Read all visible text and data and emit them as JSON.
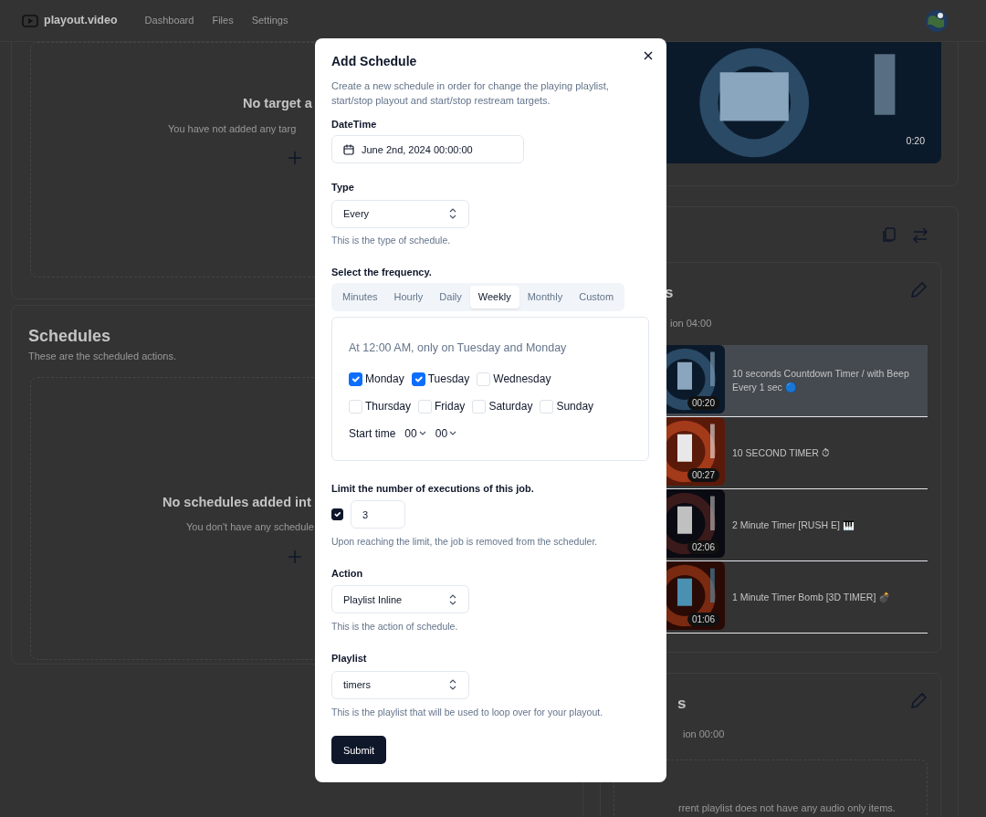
{
  "navbar": {
    "brand": "playout.video",
    "links": [
      {
        "label": "Dashboard"
      },
      {
        "label": "Files"
      },
      {
        "label": "Settings"
      }
    ]
  },
  "targets": {
    "empty_title": "No target a",
    "empty_text": "You have not added any targ"
  },
  "schedules": {
    "title": "Schedules",
    "subtitle": "These are the scheduled actions.",
    "empty_title": "No schedules added int",
    "empty_text": "You don't have any schedule"
  },
  "player": {
    "duration": "0:20"
  },
  "playlists": [
    {
      "title": "s",
      "subtitle": "ion 04:00",
      "items": [
        {
          "title": "10 seconds Countdown Timer / with Beep Every 1 sec 🔵",
          "duration": "00:20",
          "selected": true
        },
        {
          "title": "10 SECOND TIMER ⏱",
          "duration": "00:27",
          "selected": false
        },
        {
          "title": "2 Minute Timer [RUSH E] 🎹",
          "duration": "02:06",
          "selected": false
        },
        {
          "title": "1 Minute Timer Bomb [3D TIMER] 💣",
          "duration": "01:06",
          "selected": false
        }
      ]
    },
    {
      "title": "s",
      "subtitle": "ion 00:00",
      "empty_text": "rrent playlist does not have any audio only items."
    }
  ],
  "modal": {
    "title": "Add Schedule",
    "description": "Create a new schedule in order for change the playing playlist, start/stop playout and start/stop restream targets.",
    "datetime": {
      "label": "DateTime",
      "value": "June 2nd, 2024 00:00:00"
    },
    "type": {
      "label": "Type",
      "value": "Every",
      "help": "This is the type of schedule."
    },
    "frequency": {
      "label": "Select the frequency.",
      "tabs": [
        {
          "label": "Minutes",
          "selected": false
        },
        {
          "label": "Hourly",
          "selected": false
        },
        {
          "label": "Daily",
          "selected": false
        },
        {
          "label": "Weekly",
          "selected": true
        },
        {
          "label": "Monthly",
          "selected": false
        },
        {
          "label": "Custom",
          "selected": false
        }
      ],
      "summary": "At 12:00 AM, only on Tuesday and Monday",
      "day_rows": [
        [
          {
            "label": "Monday",
            "checked": true
          },
          {
            "label": "Tuesday",
            "checked": true
          },
          {
            "label": "Wednesday",
            "checked": false
          }
        ],
        [
          {
            "label": "Thursday",
            "checked": false
          },
          {
            "label": "Friday",
            "checked": false
          },
          {
            "label": "Saturday",
            "checked": false
          },
          {
            "label": "Sunday",
            "checked": false
          }
        ]
      ],
      "start_time": {
        "label": "Start time",
        "hour": "00",
        "minute": "00"
      }
    },
    "limit": {
      "label": "Limit the number of executions of this job.",
      "checked": true,
      "value": "3",
      "help": "Upon reaching the limit, the job is removed from the scheduler."
    },
    "action": {
      "label": "Action",
      "value": "Playlist Inline",
      "help": "This is the action of schedule."
    },
    "playlist": {
      "label": "Playlist",
      "value": "timers",
      "help": "This is the playlist that will be used to loop over for your playout."
    },
    "submit": "Submit"
  }
}
